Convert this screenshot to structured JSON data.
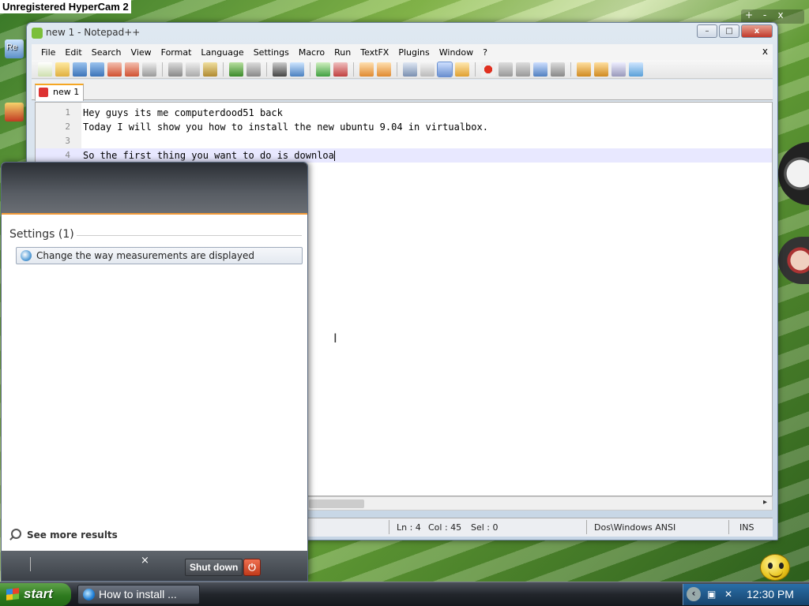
{
  "recorder": {
    "watermark": "Unregistered HyperCam 2"
  },
  "desktop": {
    "partial_label": "Re"
  },
  "notepad": {
    "title": "new 1 - Notepad++",
    "window_buttons": {
      "minimize": "–",
      "maximize": "□",
      "close": "x"
    },
    "menu": [
      "File",
      "Edit",
      "Search",
      "View",
      "Format",
      "Language",
      "Settings",
      "Macro",
      "Run",
      "TextFX",
      "Plugins",
      "Window",
      "?"
    ],
    "menu_close": "x",
    "tab": "new 1",
    "lines": [
      {
        "num": "1",
        "text": "Hey guys its me computerdood51 back"
      },
      {
        "num": "2",
        "text": "Today I will show you how to install the new ubuntu 9.04 in virtualbox."
      },
      {
        "num": "3",
        "text": ""
      },
      {
        "num": "4",
        "text": "So the first thing you want to do is downloa"
      }
    ],
    "status": {
      "line": "Ln : 4",
      "col": "Col : 45",
      "sel": "Sel : 0",
      "format": "Dos\\Windows  ANSI",
      "mode": "INS"
    },
    "scroll_arrow": "▸"
  },
  "start_menu": {
    "section_heading": "Settings (1)",
    "result": "Change the way measurements are displayed",
    "see_more": "See more results",
    "clear": "×",
    "shutdown": "Shut down",
    "power_glyph": "⏻"
  },
  "gadgets": {
    "plus": "+",
    "dash": "-",
    "close": "x"
  },
  "taskbar": {
    "start": "start",
    "task_button": "How to install ...",
    "clock": "12:30 PM",
    "tray_arrow": "‹"
  },
  "colors": {
    "start_green": "#2e7a1f",
    "menu_accent": "#f39b3a",
    "tab_accent": "#f5a623",
    "power_red": "#c03a1a"
  }
}
